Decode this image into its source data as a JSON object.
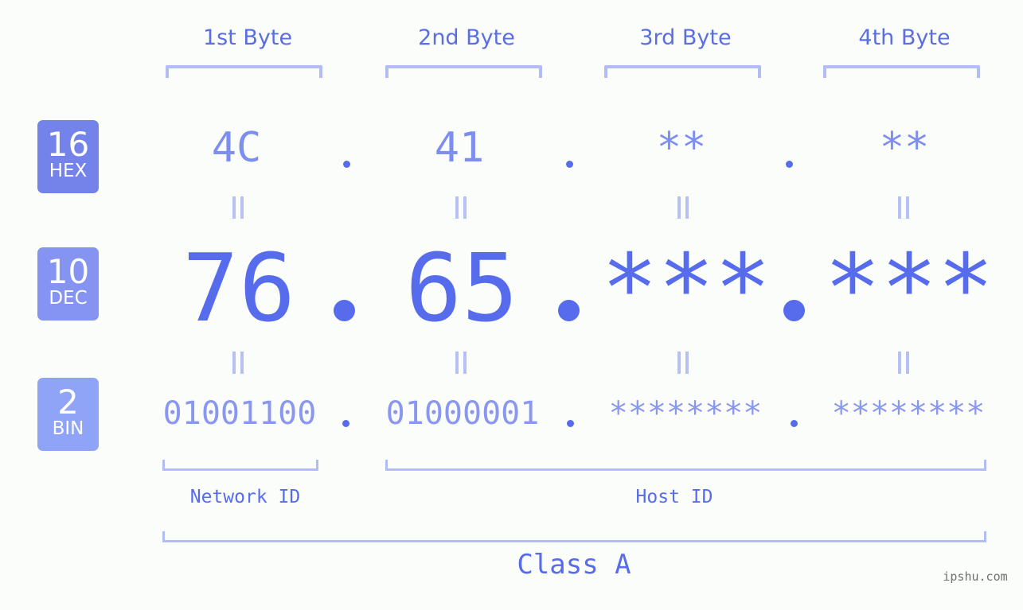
{
  "byte_headers": [
    "1st Byte",
    "2nd Byte",
    "3rd Byte",
    "4th Byte"
  ],
  "rows": {
    "hex": {
      "base": "16",
      "label": "HEX",
      "octets": [
        "4C",
        "41",
        "**",
        "**"
      ],
      "badge_color": "#7383ea"
    },
    "dec": {
      "base": "10",
      "label": "DEC",
      "octets": [
        "76",
        "65",
        "***",
        "***"
      ],
      "badge_color": "#8694f1"
    },
    "bin": {
      "base": "2",
      "label": "BIN",
      "octets": [
        "01001100",
        "01000001",
        "********",
        "********"
      ],
      "badge_color": "#8fa4f7"
    }
  },
  "separator": ".",
  "equals_glyph": "=",
  "network_id_label": "Network ID",
  "host_id_label": "Host ID",
  "class_label": "Class A",
  "watermark": "ipshu.com",
  "colors": {
    "accent": "#566cec",
    "bracket": "#b4bcf8",
    "background": "#fbfdfb"
  }
}
